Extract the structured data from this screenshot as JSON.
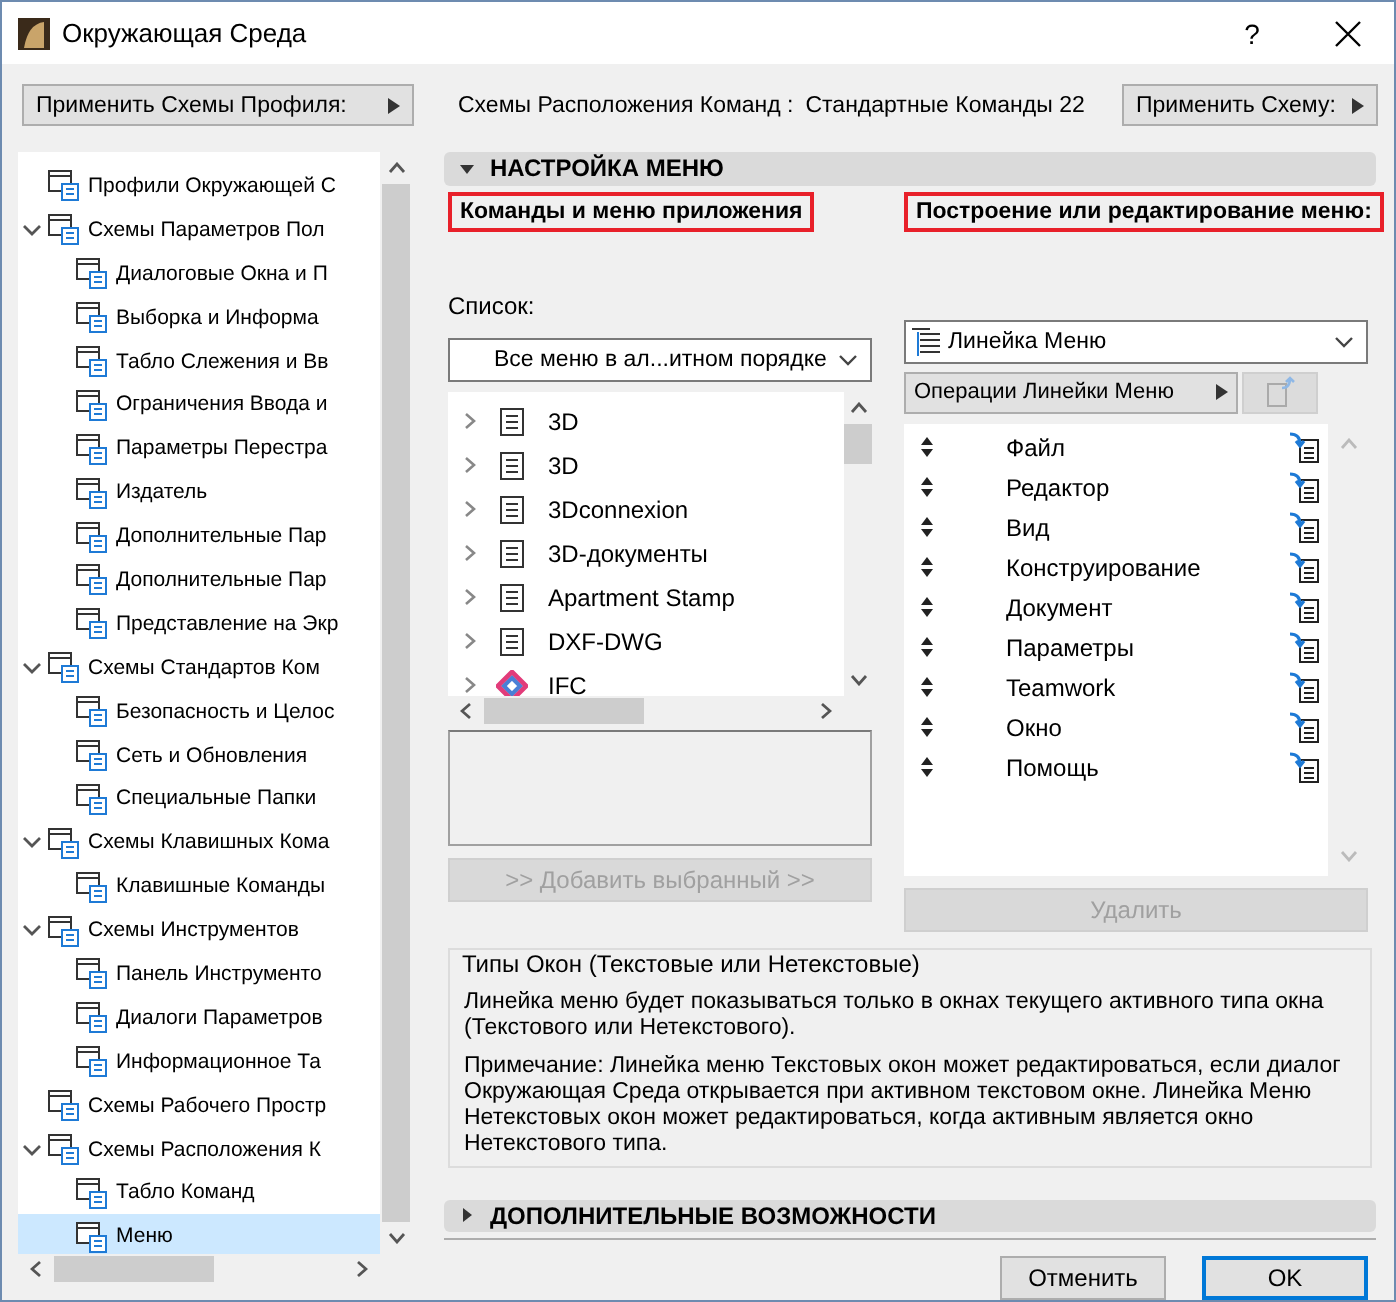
{
  "window": {
    "title": "Окружающая Среда",
    "help": "?"
  },
  "toolbar": {
    "profile_button": "Применить Схемы Профиля:",
    "scheme_label": "Схемы Расположения Команд :",
    "scheme_value": "Стандартные Команды 22",
    "apply_button": "Применить Схему:"
  },
  "sidebar": {
    "items": [
      {
        "label": "Профили Окружающей С",
        "selected": false
      },
      {
        "label": "Схемы Параметров Пол",
        "selected": false,
        "expanded": true,
        "children": [
          {
            "label": "Диалоговые Окна и П",
            "selected": false
          },
          {
            "label": "Выборка и Информа",
            "selected": false
          },
          {
            "label": "Табло Слежения и Вв",
            "selected": false
          },
          {
            "label": "Ограничения Ввода и",
            "selected": false
          },
          {
            "label": "Параметры Перестра",
            "selected": false
          },
          {
            "label": "Издатель",
            "selected": false
          },
          {
            "label": "Дополнительные Пар",
            "selected": false
          },
          {
            "label": "Дополнительные Пар",
            "selected": false
          },
          {
            "label": "Представление на Экр",
            "selected": false
          }
        ]
      },
      {
        "label": "Схемы Стандартов Ком",
        "selected": false,
        "expanded": true,
        "children": [
          {
            "label": "Безопасность и Целос",
            "selected": false
          },
          {
            "label": "Сеть и Обновления",
            "selected": false
          },
          {
            "label": "Специальные Папки",
            "selected": false
          }
        ]
      },
      {
        "label": "Схемы Клавишных Кома",
        "selected": false,
        "expanded": true,
        "children": [
          {
            "label": "Клавишные Команды",
            "selected": false
          }
        ]
      },
      {
        "label": "Схемы Инструментов",
        "selected": false,
        "expanded": true,
        "children": [
          {
            "label": "Панель Инструменто",
            "selected": false
          },
          {
            "label": "Диалоги Параметров",
            "selected": false
          },
          {
            "label": "Информационное Та",
            "selected": false
          }
        ]
      },
      {
        "label": "Схемы Рабочего Простр",
        "selected": false
      },
      {
        "label": "Схемы Расположения К",
        "selected": false,
        "expanded": true,
        "children": [
          {
            "label": "Табло Команд",
            "selected": false
          },
          {
            "label": "Меню",
            "selected": true
          }
        ]
      }
    ]
  },
  "menu_settings": {
    "title": "НАСТРОЙКА МЕНЮ",
    "expanded": true,
    "left": {
      "heading": "Команды и меню приложения",
      "list_label": "Список:",
      "dropdown": "Все меню в ал...итном порядке",
      "items": [
        {
          "label": "3D",
          "kind": "menu"
        },
        {
          "label": "3D",
          "kind": "menu"
        },
        {
          "label": "3Dconnexion",
          "kind": "menu"
        },
        {
          "label": "3D-документы",
          "kind": "menu"
        },
        {
          "label": "Apartment Stamp",
          "kind": "menu"
        },
        {
          "label": "DXF-DWG",
          "kind": "menu"
        },
        {
          "label": "IFC",
          "kind": "addon"
        }
      ],
      "add_button": {
        "label": ">> Добавить выбранный >>",
        "disabled": true
      }
    },
    "right": {
      "heading": "Построение или редактирование меню:",
      "dropdown": "Линейка Меню",
      "operations_button": "Операции Линейки Меню",
      "items": [
        {
          "label": "Файл"
        },
        {
          "label": "Редактор"
        },
        {
          "label": "Вид"
        },
        {
          "label": "Конструирование"
        },
        {
          "label": "Документ"
        },
        {
          "label": "Параметры"
        },
        {
          "label": "Teamwork"
        },
        {
          "label": "Окно"
        },
        {
          "label": "Помощь"
        }
      ],
      "delete_button": {
        "label": "Удалить",
        "disabled": true
      }
    },
    "info": {
      "title": "Типы Окон (Текстовые или Нетекстовые)",
      "paragraphs": [
        "Линейка меню будет показываться только в окнах текущего активного типа окна (Текстового или Нетекстового).",
        "Примечание: Линейка меню Текстовых окон может редактироваться, если диалог Окружающая Среда открывается при активном текстовом окне. Линейка Меню Нетекстовых окон может редактироваться, когда активным является окно Нетекстового типа."
      ]
    }
  },
  "advanced": {
    "title": "ДОПОЛНИТЕЛЬНЫЕ ВОЗМОЖНОСТИ",
    "expanded": false
  },
  "buttons": [
    {
      "label": "Отменить",
      "default": false
    },
    {
      "label": "OK",
      "default": true
    }
  ]
}
